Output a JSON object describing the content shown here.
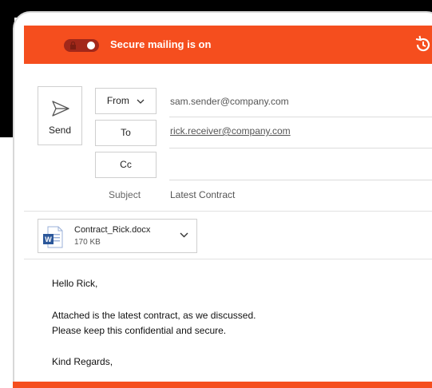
{
  "colors": {
    "accent": "#f54e1e",
    "toggle_track": "#a2281a",
    "border": "#cfcfcf"
  },
  "header": {
    "secure_toggle_state": "on",
    "secure_label": "Secure mailing is on",
    "icons": {
      "lock": "lock-icon",
      "history": "history-icon"
    }
  },
  "send": {
    "label": "Send",
    "icon": "send-icon"
  },
  "fields": {
    "from": {
      "label": "From",
      "value": "sam.sender@company.com"
    },
    "to": {
      "label": "To",
      "value": "rick.receiver@company.com"
    },
    "cc": {
      "label": "Cc",
      "value": ""
    },
    "subject": {
      "label": "Subject",
      "value": "Latest Contract"
    }
  },
  "attachment": {
    "name": "Contract_Rick.docx",
    "size": "170 KB",
    "icon": "word-file-icon"
  },
  "message": {
    "greeting": "Hello Rick,",
    "line1": "Attached is the latest contract, as we discussed.",
    "line2": "Please keep this confidential and secure.",
    "closing": "Kind Regards,"
  }
}
